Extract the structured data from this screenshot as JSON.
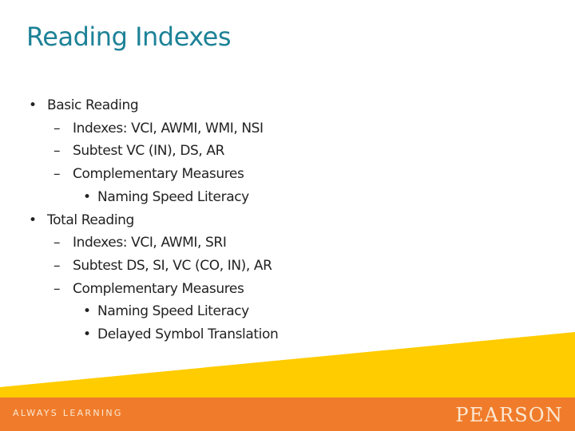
{
  "slide": {
    "title": "Reading Indexes",
    "bullets": [
      {
        "level": 1,
        "marker": "•",
        "text": "Basic Reading"
      },
      {
        "level": 2,
        "marker": "–",
        "text": "Indexes: VCI, AWMI, WMI, NSI"
      },
      {
        "level": 2,
        "marker": "–",
        "text": "Subtest VC (IN), DS, AR"
      },
      {
        "level": 2,
        "marker": "–",
        "text": "Complementary Measures"
      },
      {
        "level": 3,
        "marker": "•",
        "text": "Naming Speed Literacy"
      },
      {
        "level": 1,
        "marker": "•",
        "text": "Total Reading"
      },
      {
        "level": 2,
        "marker": "–",
        "text": "Indexes: VCI, AWMI, SRI"
      },
      {
        "level": 2,
        "marker": "–",
        "text": "Subtest DS, SI, VC (CO, IN), AR"
      },
      {
        "level": 2,
        "marker": "–",
        "text": "Complementary Measures"
      },
      {
        "level": 3,
        "marker": "•",
        "text": "Naming Speed Literacy"
      },
      {
        "level": 3,
        "marker": "•",
        "text": "Delayed Symbol Translation"
      }
    ]
  },
  "footer": {
    "tagline": "ALWAYS LEARNING",
    "brand": "PEARSON",
    "colors": {
      "accent_yellow": "#ffcc00",
      "band_orange": "#f07c2b",
      "title_teal": "#1d8297"
    }
  }
}
